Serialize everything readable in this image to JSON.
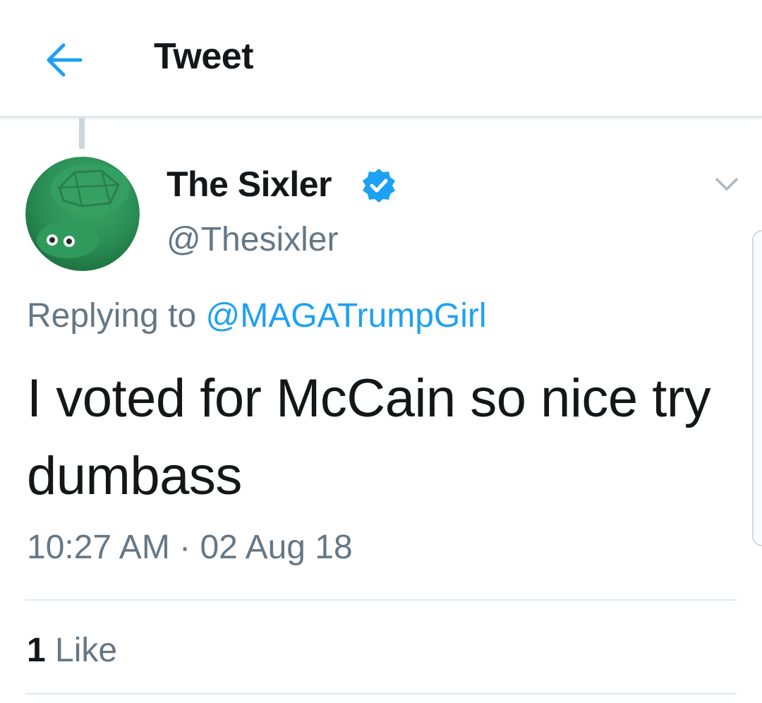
{
  "header": {
    "title": "Tweet",
    "back_icon": "arrow-left-icon",
    "accent_color": "#1da1f2"
  },
  "tweet": {
    "display_name": "The Sixler",
    "verified": true,
    "handle": "@Thesixler",
    "reply_prefix": "Replying to",
    "reply_to": "@MAGATrumpGirl",
    "text": "I voted for McCain so nice try dumbass",
    "time": "10:27 AM",
    "separator": "·",
    "date": "02 Aug 18",
    "like_count": "1",
    "like_label": "Like"
  }
}
